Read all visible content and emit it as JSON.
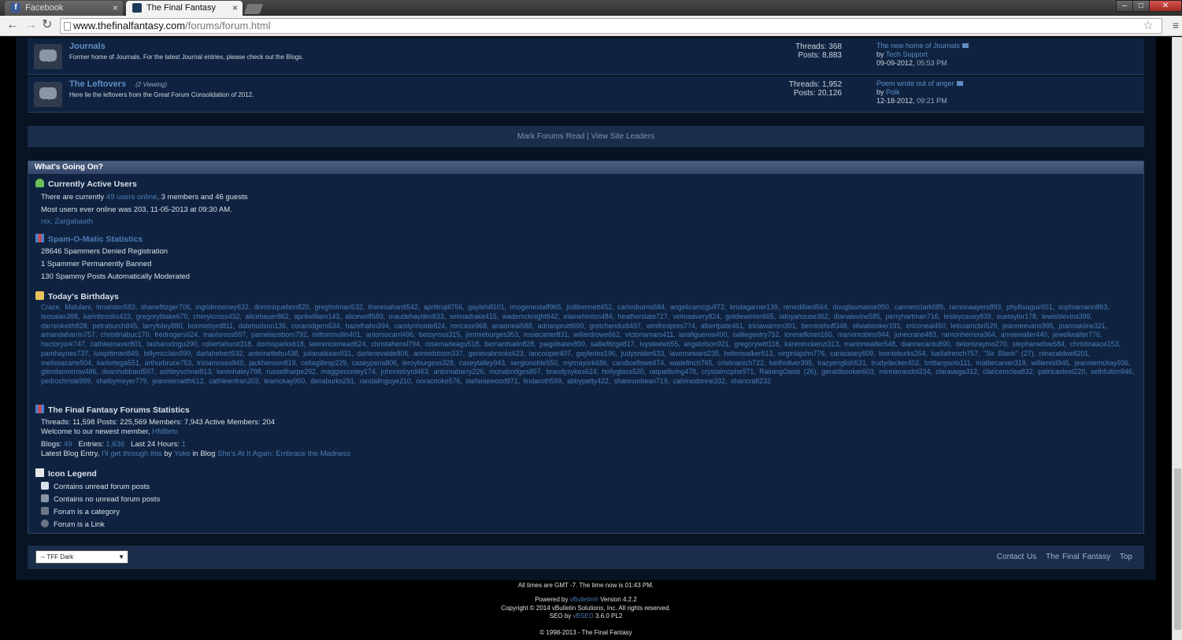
{
  "browser": {
    "tabs": [
      {
        "title": "Facebook"
      },
      {
        "title": "The Final Fantasy Forums"
      }
    ],
    "url_domain": "www.thefinalfantasy.com",
    "url_path": "/forums/forum.html"
  },
  "forums": [
    {
      "name": "Journals",
      "viewing": "",
      "description": "Former home of Journals. For the latest Journal entries, please check out the Blogs.",
      "threads": "Threads: 368",
      "posts": "Posts: 8,883",
      "last_title": "The new home of Journals",
      "last_by": "Tech Support",
      "last_date": "09-09-2012,",
      "last_time": "05:53 PM"
    },
    {
      "name": "The Leftovers",
      "viewing": "(2 Viewing)",
      "description": "Here lie the leftovers from the Great Forum Consolidation of 2012.",
      "threads": "Threads: 1,952",
      "posts": "Posts: 20,126",
      "last_title": "Poem wrote out of anger",
      "last_by": "Polk",
      "last_date": "12-18-2012,",
      "last_time": "09:21 PM"
    }
  ],
  "by_label": "by",
  "mark_read": "Mark Forums Read",
  "sep": "|",
  "site_leaders": "View Site Leaders",
  "wgo": {
    "title": "What's Going On?",
    "active_title": "Currently Active Users",
    "active_pre": "There are currently",
    "active_link": "49 users online",
    "active_post": ". 3 members and 46 guests",
    "most_users": "Most users ever online was 203, 11-05-2013 at 09:30 AM.",
    "active_names": "nix, Zargabaath",
    "spam_title": "Spam-O-Matic Statistics",
    "spam1": "28646 Spammers Denied Registration",
    "spam2": "1 Spammer Permanently Banned",
    "spam3": "130 Spammy Posts Automatically Moderated",
    "bday_title": "Today's Birthdays",
    "birthdays": "Craze, Malulani, timalston583, shanefitzger706, ingridmooney632, dominiquebon820, gregholman532, theresahardi542, apriltrujill756, gaylehill101, imogenestaff965, jodibennett452, carlosburns684, angelicamcgu972, kristagarner139, renedillard564, douglasmasse950, carmenclark685, ramonaayers893, phyllisaguir651, sophiamann863, leosalas388, karinbrooks423, gregoryblake670, cherylcross432, alicebauer862, aprilwilliam143, alicewolf689, maudehayden833, selmadrake415, wademcknight642, elainehinton484, heatherslate727, velmaavery824, goldiewinter665, latoyahouse362, dianalevine585, perryhartman716, lesleycasey839, suetaylor178, lewisblevins399, darrenkeith828, petraburch845, larryfoley880, bonniebyrd811, dalehudson136, corarodgers534, hazelhahn394, carolynholde824, roncase968, anaoneal588, adrianpruitt699, gretchendudl497, winifredpres774, albertpate461, triciawarren391, bernicehuff348, silviabooker191, ericoneal450, leticiamcbri529, jeanneevans995, joannakline321, amandaharrin757, christinabuc170, fredrogers624, mavisross597, pamelaosborn792, miltonmullin401, antoniocarri496, betsyross315, jimmieburges353, rosiecarter831, willardrowe662, victoriamars411, larafigueroa400, salliegentry752, loreneflores160, marvinrobins944, junecrane483, ramonherrera364, anniewaller440, jewellwalter776, hectoryork747, cathleenaver801, tasharodrigu290, robertahurst318, dorissparks618, lawrencemead624, christahensl794, rosemarieagu518, bernardsalin828, paigebates890, salliefitzge817, ivysteele655, angelolson921, gregorywitt118, karenmckenzi313, marionwalter548, diannecantu890, delorisraymo270, stephaniefow584, christinaace153, pamhaynes737, luispittman849, billymcclain990, darlahebert532, antoinettebu438, julianalexan931, darlenevalde806, anniedotson337, genevabrooks623, iancooper407, gaylerios196, judysnider633, laverneward235, helenwalker513, virginiajohn776, caracasey609, lonnieburks264, luellafrench757, \"Sir Blank\" (27), ninacaldwell201, melissacarte504, karlortega551, arthurbruce753, triciamoses940, jackhenson819, celiagillesp229, caseypena806, leroyburgess328, caseytalley943, sergionoble550, myrnayork686, candiceflowe474, wadefinch765, cristinanich722, keitholiver395, tracyenglish531, trudydecker402, brittanysolo111, mattiecarver319, williereid945, jeanniemckay936, glendamorrow486, deanhubbard597, ashleyschnei813, kevinhaley798, russellharpe292, maggieconley174, johnniebyrd463, antoniabarry226, monabridges857, brandysykes624, hollyglass520, raquelliving478, crystalmcphe971, RainingOasis (26), geraldbooker603, minnierandol234, claravega312, claricemclea832, patricasteel220, sethfulton946, pedrochriste999, shelbymeyer779, jeanniematth612, cathleenfran203, leamckay950, denaburks291, randallnguye210, noracooke576, stefaniewood971, lindaroth599, abbypetty422, shannonbean719, calvinodonne332, sharicraft232",
    "stats_title": "The Final Fantasy Forums Statistics",
    "stats_line1": "Threads: 11,598   Posts: 225,569   Members: 7,943   Active Members: 204",
    "newest_pre": "Welcome to our newest member,",
    "newest_name": "Hfdtleto",
    "blogs_pre": "Blogs:",
    "blogs_val": "49",
    "entries_pre": "Entries:",
    "entries_val": "1,636",
    "last24_pre": "Last 24 Hours:",
    "last24_val": "1",
    "blog_entry_pre": "Latest Blog Entry,",
    "blog_entry_title": "I'll get through this",
    "blog_by": "by",
    "blog_author": "Yoko",
    "blog_in": "in Blog",
    "blog_name": "She's At It Again: Embrace the Madness",
    "legend_title": "Icon Legend",
    "legend": [
      "Contains unread forum posts",
      "Contains no unread forum posts",
      "Forum is a category",
      "Forum is a Link"
    ]
  },
  "footer": {
    "style_select": "-- TFF Dark",
    "contact": "Contact Us",
    "home": "The Final Fantasy",
    "top": "Top",
    "times": "All times are GMT -7. The time now is 01:43 PM.",
    "powered_pre": "Powered by",
    "powered_link": "vBulletin®",
    "powered_post": "Version 4.2.2",
    "copyright": "Copyright © 2014 vBulletin Solutions, Inc. All rights reserved.",
    "seo_pre": "SEO by",
    "seo_link": "vBSEO",
    "seo_post": "3.6.0 PL2",
    "site_copy": "© 1998-2013 - The Final Fantasy"
  },
  "colors": {
    "page_bg": "#081423",
    "panel_bg": "#0f2340",
    "link": "#4b7cb5",
    "header_bar": "#3c5073"
  }
}
